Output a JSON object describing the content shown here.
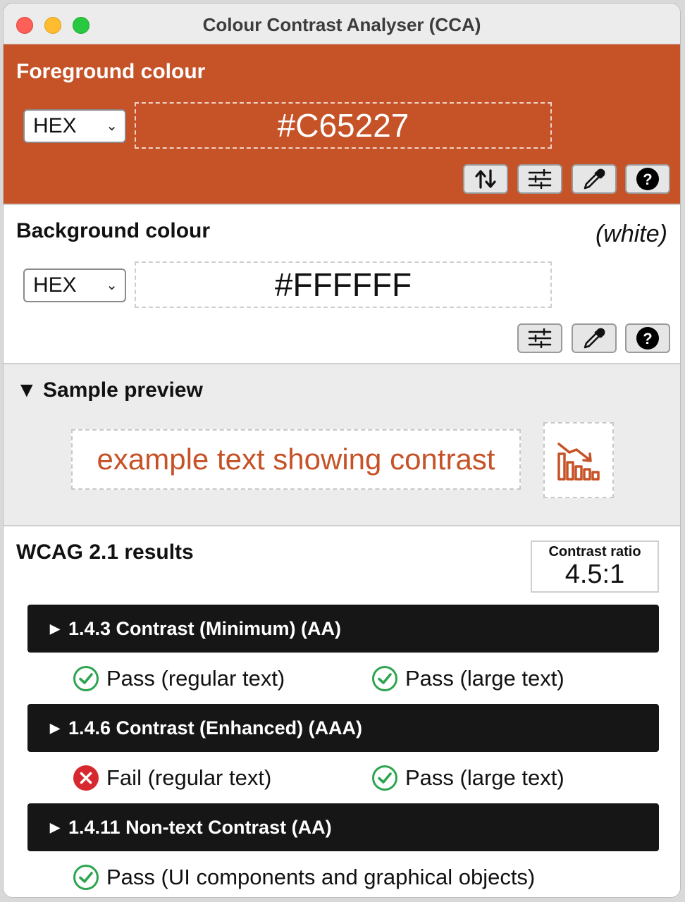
{
  "window": {
    "title": "Colour Contrast Analyser (CCA)"
  },
  "foreground": {
    "heading": "Foreground colour",
    "format": "HEX",
    "value": "#C65227",
    "color": "#C65227",
    "tools": [
      "swap-icon",
      "sliders-icon",
      "eyedropper-icon",
      "help-icon"
    ]
  },
  "background": {
    "heading": "Background colour",
    "name": "(white)",
    "format": "HEX",
    "value": "#FFFFFF",
    "color": "#FFFFFF",
    "tools": [
      "sliders-icon",
      "eyedropper-icon",
      "help-icon"
    ]
  },
  "preview": {
    "heading": "Sample preview",
    "sample_text": "example text showing contrast",
    "graphic_icon": "chart-icon"
  },
  "results": {
    "heading": "WCAG 2.1 results",
    "ratio_label": "Contrast ratio",
    "ratio_value": "4.5:1",
    "criteria": [
      {
        "label": "1.4.3 Contrast (Minimum) (AA)",
        "items": [
          {
            "status": "pass",
            "text": "Pass (regular text)"
          },
          {
            "status": "pass",
            "text": "Pass (large text)"
          }
        ]
      },
      {
        "label": "1.4.6 Contrast (Enhanced) (AAA)",
        "items": [
          {
            "status": "fail",
            "text": "Fail (regular text)"
          },
          {
            "status": "pass",
            "text": "Pass (large text)"
          }
        ]
      },
      {
        "label": "1.4.11 Non-text Contrast (AA)",
        "items": [
          {
            "status": "pass",
            "text": "Pass (UI components and graphical objects)"
          }
        ]
      }
    ]
  },
  "colors": {
    "pass": "#2ea44f",
    "fail": "#d7282f"
  }
}
